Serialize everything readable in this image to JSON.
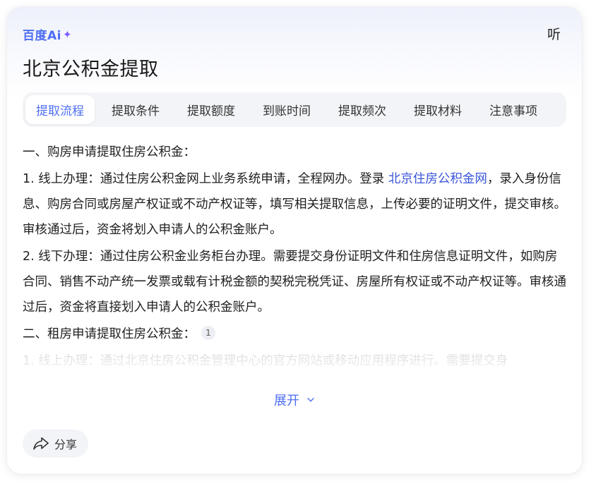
{
  "header": {
    "brand": "百度Ai",
    "brand_star": "✦",
    "listen_label": "听"
  },
  "title": "北京公积金提取",
  "tabs": [
    {
      "label": "提取流程",
      "active": true
    },
    {
      "label": "提取条件",
      "active": false
    },
    {
      "label": "提取额度",
      "active": false
    },
    {
      "label": "到账时间",
      "active": false
    },
    {
      "label": "提取频次",
      "active": false
    },
    {
      "label": "提取材料",
      "active": false
    },
    {
      "label": "注意事项",
      "active": false
    }
  ],
  "content": {
    "section1_heading": "一、购房申请提取住房公积金：",
    "item1_prefix": "1. 线上办理：通过住房公积金网上业务系统申请，全程网办。登录 ",
    "item1_link": "北京住房公积金网",
    "item1_suffix": "，录入身份信息、购房合同或房屋产权证或不动产权证等，填写相关提取信息，上传必要的证明文件，提交审核。审核通过后，资金将划入申请人的公积金账户。",
    "item2": "2. 线下办理：通过住房公积金业务柜台办理。需要提交身份证明文件和住房信息证明文件，如购房合同、销售不动产统一发票或载有计税金额的契税完税凭证、房屋所有权证或不动产权证等。审核通过后，资金将直接划入申请人的公积金账户。",
    "section2_heading": "二、租房申请提取住房公积金：",
    "section2_ref": "1",
    "faded_line": "1. 线上办理：通过北京住房公积金管理中心的官方网站或移动应用程序进行。需要提交身"
  },
  "footer": {
    "expand_label": "展开",
    "share_label": "分享"
  },
  "colors": {
    "accent": "#4e6ef2",
    "link": "#3b55d9"
  }
}
